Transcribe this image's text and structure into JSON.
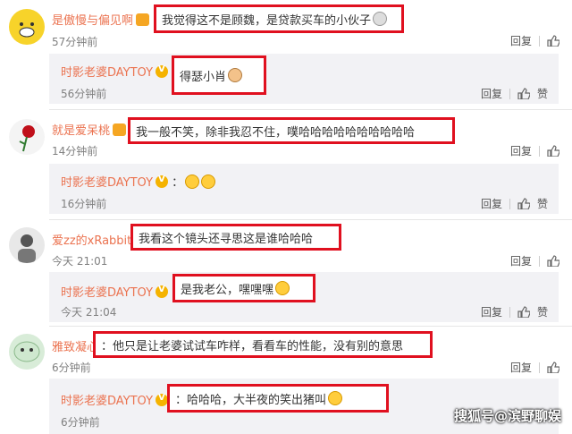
{
  "labels": {
    "reply": "回复",
    "like": "赞"
  },
  "comments": [
    {
      "user": "是傲慢与偏见啊",
      "text": "我觉得这不是顾魏，是贷款买车的小伙子",
      "time": "57分钟前",
      "reply": {
        "user": "时影老婆DAYTOY",
        "text": "得瑟小肖",
        "time": "56分钟前"
      }
    },
    {
      "user": "就是爱呆桃",
      "text": "我一般不笑，除非我忍不住，噗哈哈哈哈哈哈哈哈哈哈",
      "time": "14分钟前",
      "reply": {
        "user": "时影老婆DAYTOY",
        "text": "：",
        "time": "16分钟前"
      }
    },
    {
      "user": "爱zz的xRabbit",
      "text": "我看这个镜头还寻思这是谁哈哈哈",
      "time": "今天 21:01",
      "reply": {
        "user": "时影老婆DAYTOY",
        "text": "是我老公，嘿嘿嘿",
        "time": "今天 21:04"
      }
    },
    {
      "user": "雅致凝心",
      "text": "：他只是让老婆试试车咋样，看看车的性能，没有别的意思",
      "time": "6分钟前",
      "reply": {
        "user": "时影老婆DAYTOY",
        "text": "：哈哈哈，大半夜的笑出猪叫",
        "time": "6分钟前"
      }
    }
  ],
  "watermark": "搜狐号@滨野聊娱"
}
